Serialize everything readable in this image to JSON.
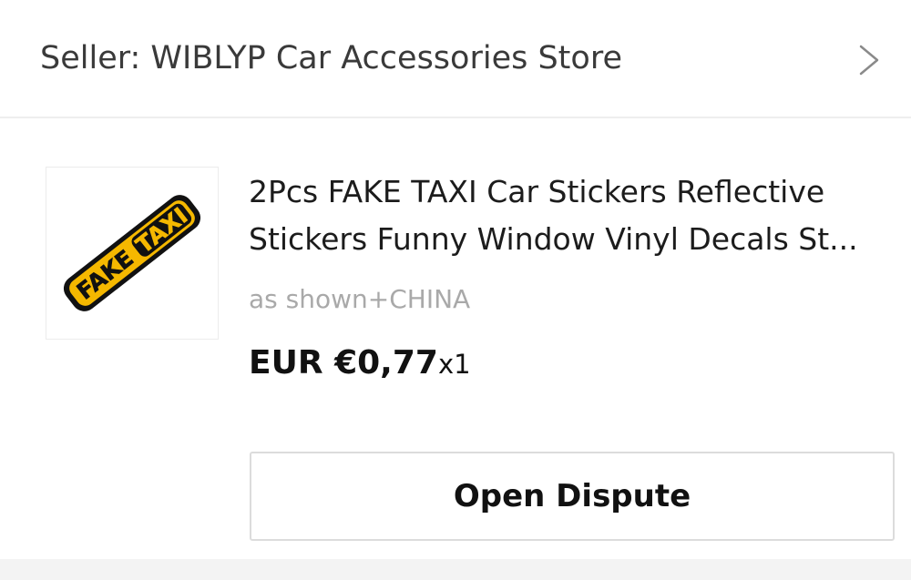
{
  "seller": {
    "label": "Seller: WIBLYP Car Accessories Store",
    "chevron_icon": "chevron-right-icon"
  },
  "product": {
    "image_icon": "fake-taxi-sticker-image",
    "title_line1": "2Pcs FAKE TAXI Car Stickers Reflective",
    "title_line2": "Stickers Funny Window Vinyl Decals St...",
    "variant": "as shown+CHINA",
    "price": "EUR €0,77",
    "quantity": "x1"
  },
  "actions": {
    "open_dispute_label": "Open Dispute"
  },
  "colors": {
    "sticker_yellow": "#f5b800",
    "sticker_black": "#111111",
    "muted_text": "#a9a9a9"
  }
}
